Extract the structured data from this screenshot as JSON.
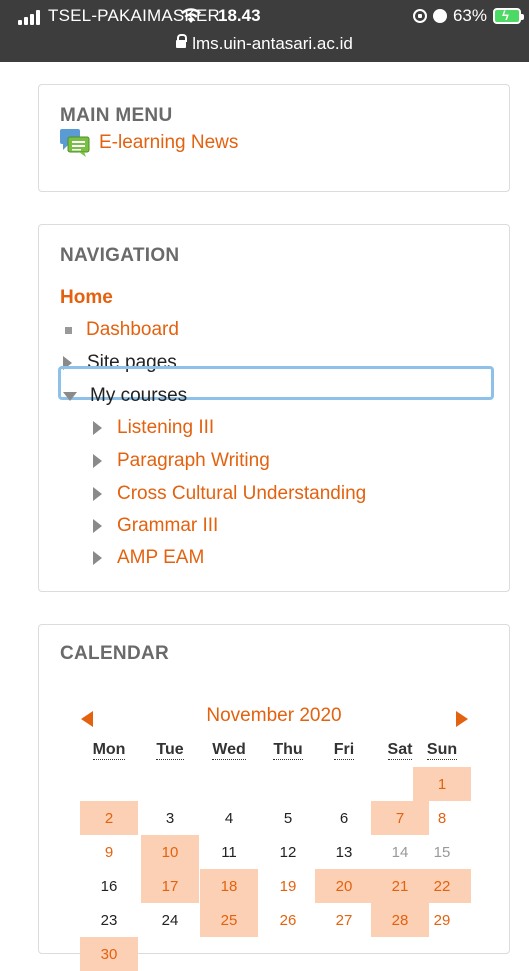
{
  "status_bar": {
    "carrier": "TSEL-PAKAIMASKER",
    "time": "18.43",
    "battery": "63%",
    "url": "lms.uin-antasari.ac.id"
  },
  "main_menu": {
    "title": "MAIN MENU",
    "items": [
      {
        "label": "E-learning News",
        "icon": "forum-chat-icon"
      }
    ]
  },
  "navigation": {
    "title": "NAVIGATION",
    "home": "Home",
    "items": [
      {
        "label": "Dashboard",
        "icon": "square-bullet-icon"
      },
      {
        "label": "Site pages",
        "icon": "triangle-right-icon"
      },
      {
        "label": "My courses",
        "icon": "triangle-down-icon",
        "focused": true
      }
    ],
    "courses": [
      {
        "label": "Listening III"
      },
      {
        "label": "Paragraph Writing"
      },
      {
        "label": "Cross Cultural Understanding"
      },
      {
        "label": "Grammar III"
      },
      {
        "label": "AMP EAM"
      }
    ]
  },
  "calendar": {
    "title": "CALENDAR",
    "month": "November 2020",
    "prev_icon": "arrow-left-icon",
    "next_icon": "arrow-right-icon",
    "weekdays": [
      "Mon",
      "Tue",
      "Wed",
      "Thu",
      "Fri",
      "Sat",
      "Sun"
    ],
    "weeks": [
      [
        "",
        "",
        "",
        "",
        "",
        "",
        "1"
      ],
      [
        "2",
        "3",
        "4",
        "5",
        "6",
        "7",
        "8"
      ],
      [
        "9",
        "10",
        "11",
        "12",
        "13",
        "14",
        "15"
      ],
      [
        "16",
        "17",
        "18",
        "19",
        "20",
        "21",
        "22"
      ],
      [
        "23",
        "24",
        "25",
        "26",
        "27",
        "28",
        "29"
      ],
      [
        "30",
        "",
        "",
        "",
        "",
        "",
        ""
      ]
    ],
    "event_days": [
      "1",
      "2",
      "7",
      "10",
      "17",
      "18",
      "20",
      "21",
      "22",
      "25",
      "28",
      "30"
    ],
    "orange_text_days": [
      "8",
      "9",
      "19",
      "26",
      "27",
      "29"
    ],
    "muted_days": [
      "14",
      "15"
    ],
    "colors": {
      "accent": "#e3620f",
      "event_bg": "#fbd0b5"
    }
  }
}
